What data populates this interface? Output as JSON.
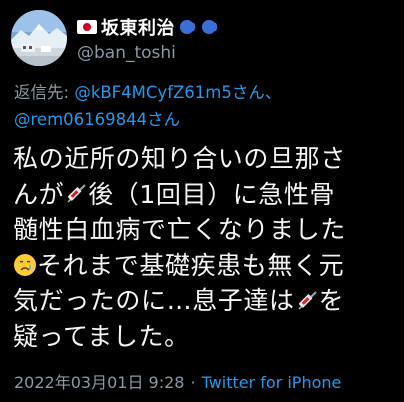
{
  "author": {
    "display_name": "坂東利治",
    "handle": "@ban_toshi",
    "avatar_icon": "mountain-landscape-avatar",
    "flag_icon": "japan-flag-icon",
    "speaker_icon": "speaking-head-icon"
  },
  "reply": {
    "prefix": "返信先: ",
    "mention_line1": "@kBF4MCyfZ61m5さん、",
    "mention_line2": "@rem06169844さん"
  },
  "body": {
    "line1": "私の近所の知り合いの旦那さ",
    "line2_a": "んが",
    "line2_b": "後（1回目）に急性骨",
    "line3": "髄性白血病で亡くなりました",
    "line4": "それまで基礎疾患も無く元",
    "line5_a": "気だったのに…息子達は",
    "line5_b": "を",
    "line6": "疑ってました。"
  },
  "meta": {
    "timestamp": "2022年03月01日 9:28",
    "separator": "·",
    "source": "Twitter for iPhone"
  },
  "colors": {
    "background": "#000000",
    "link": "#1d9bf0",
    "secondary": "#8b98a5"
  }
}
